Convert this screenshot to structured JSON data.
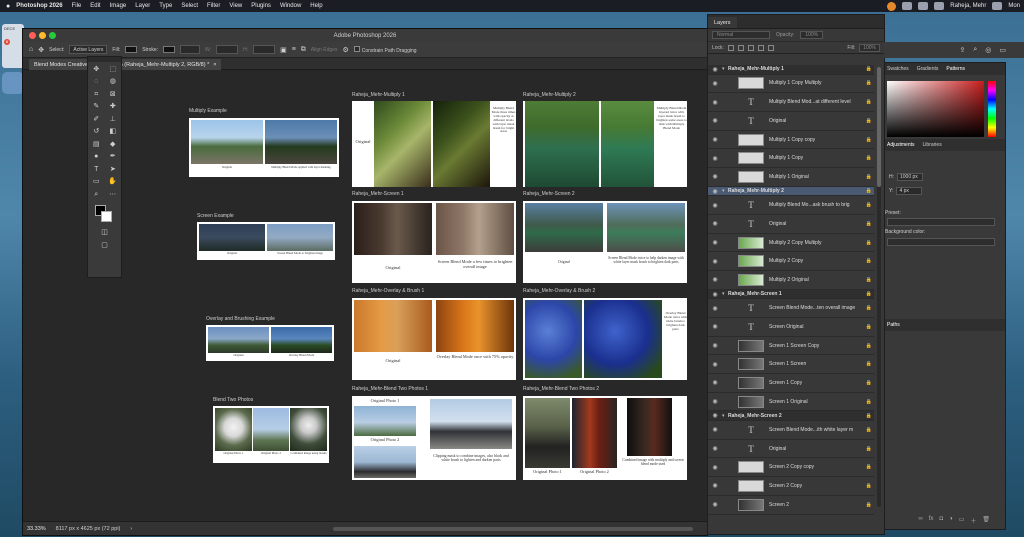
{
  "menubar": {
    "app_name": "Photoshop 2026",
    "items": [
      "File",
      "Edit",
      "Image",
      "Layer",
      "Type",
      "Select",
      "Filter",
      "View",
      "Plugins",
      "Window",
      "Help"
    ],
    "user": "Raheja, Mehr",
    "clock": "Mon"
  },
  "desktop": {
    "calendar_label": "DECE",
    "calendar_today": "8"
  },
  "window": {
    "title": "Adobe Photoshop 2026"
  },
  "options_bar": {
    "select_label": "Select:",
    "select_value": "Active Layers",
    "fill_label": "Fill:",
    "stroke_label": "Stroke:",
    "w_label": "W:",
    "h_label": "H:",
    "align_edges": "Align Edges",
    "constrain_label": "Constrain Path Dragging"
  },
  "document_tab": {
    "title": "Blend Modes Creative.psd @ 33.3% (Raheja_Mehr-Multiply 2, RGB/8) *"
  },
  "status_bar": {
    "zoom": "33.33%",
    "doc_size": "8117 px x 4625 px (72 ppi)"
  },
  "artboards": {
    "multiply_example": {
      "label": "Multiply Example",
      "cap_left": "Original",
      "cap_right": "Multiply Blend Mode applied with layer masking"
    },
    "screen_example": {
      "label": "Screen Example",
      "cap_left": "Original",
      "cap_right": "Screen Blend Mode to brighten image"
    },
    "overlay_example": {
      "label": "Overlay and Brushing Example",
      "cap_left": "Original",
      "cap_right": "Overlay Blend Mode"
    },
    "blend_two_example": {
      "label": "Blend Two Photos",
      "cap_1": "Original Photo 1",
      "cap_2": "Original Photo 2",
      "cap_3": "Combined image using masks"
    },
    "multiply1": {
      "label": "Raheja_Mehr-Multiply 1",
      "cap_left": "Original",
      "cap_right": "Multiply Blend Mode three times with opacity at different levels with layer mask brush for bright areas"
    },
    "multiply2": {
      "label": "Raheja_Mehr-Multiply 2",
      "cap_right": "Multiply Blend Mode layered twice with layer mask brush to brighten some areas to dark with Multiply Blend Mode"
    },
    "screen1": {
      "label": "Raheja_Mehr-Screen 1",
      "cap_left": "Original",
      "cap_right": "Screen Blend Mode a few times to brighten overall image"
    },
    "screen2": {
      "label": "Raheja_Mehr-Screen 2",
      "cap_left": "Original",
      "cap_right": "Screen Blend Mode twice to help darken image with white layer mask brush to brighten dark parts"
    },
    "overlay1": {
      "label": "Raheja_Mehr-Overlay & Brush 1",
      "cap_left": "Original",
      "cap_right": "Overlay Blend Mode once with 75% opacity"
    },
    "overlay2": {
      "label": "Raheja_Mehr-Overlay & Brush 2",
      "cap_right": "Overlay Blend Mode twice with white brush to brighten dark parts"
    },
    "blend1": {
      "label": "Raheja_Mehr-Blend Two Photos 1",
      "cap_top": "Original Photo 1",
      "cap_mid": "Original Photo 2",
      "cap_right": "Clipping mask to combine images, also black and white brush to lighten and darken parts"
    },
    "blend2": {
      "label": "Raheja_Mehr-Blend Two Photos 2",
      "cap_1": "Original Photo 1",
      "cap_2": "Original Photo 2",
      "cap_3": "Combined image with multiply and screen blend mode used"
    }
  },
  "layers_panel": {
    "tab": "Layers",
    "blend_mode": "Normal",
    "opacity_label": "Opacity:",
    "opacity_value": "100%",
    "lock_label": "Lock:",
    "fill_label": "Fill:",
    "fill_value": "100%",
    "rows": [
      {
        "kind": "group",
        "name": "Raheja_Mehr-Multiply 1"
      },
      {
        "kind": "image",
        "name": "Multiply 1 Copy Multiply",
        "thumb": "light"
      },
      {
        "kind": "text",
        "name": "Multiply Blend Mod...at different level"
      },
      {
        "kind": "text",
        "name": "Original"
      },
      {
        "kind": "image",
        "name": "Multiply 1 Copy copy",
        "thumb": "light"
      },
      {
        "kind": "image",
        "name": "Multiply 1 Copy",
        "thumb": "light"
      },
      {
        "kind": "image",
        "name": "Multiply 1 Original",
        "thumb": "light"
      },
      {
        "kind": "group",
        "name": "Raheja_Mehr-Multiply 2",
        "selected": true
      },
      {
        "kind": "text",
        "name": "Multiply Blend Mo...ask brush to brig"
      },
      {
        "kind": "text",
        "name": "Original"
      },
      {
        "kind": "image",
        "name": "Multiply 2 Copy Multiply",
        "thumb": "green"
      },
      {
        "kind": "image",
        "name": "Multiply 2 Copy",
        "thumb": "green"
      },
      {
        "kind": "image",
        "name": "Multiply 2 Original",
        "thumb": "green"
      },
      {
        "kind": "group",
        "name": "Raheja_Mehr-Screen 1"
      },
      {
        "kind": "text",
        "name": "Screen Blend Mode...ten overall image"
      },
      {
        "kind": "text",
        "name": "Screen Original"
      },
      {
        "kind": "image",
        "name": "Screen 1 Screen Copy",
        "thumb": "dark"
      },
      {
        "kind": "image",
        "name": "Screen 1 Screen",
        "thumb": "dark"
      },
      {
        "kind": "image",
        "name": "Screen 1 Copy",
        "thumb": "dark"
      },
      {
        "kind": "image",
        "name": "Screen 1 Original",
        "thumb": "dark"
      },
      {
        "kind": "group",
        "name": "Raheja_Mehr-Screen 2"
      },
      {
        "kind": "text",
        "name": "Screen Blend Mode...ith white layer m"
      },
      {
        "kind": "text",
        "name": "Original"
      },
      {
        "kind": "image",
        "name": "Screen 2 Copy copy",
        "thumb": "light"
      },
      {
        "kind": "image",
        "name": "Screen 2 Copy",
        "thumb": "light"
      },
      {
        "kind": "image",
        "name": "Screen 2",
        "thumb": "dark"
      }
    ]
  },
  "right_panel": {
    "tabs": [
      "Swatches",
      "Gradients",
      "Patterns"
    ],
    "tabs2": [
      "Adjustments",
      "Libraries"
    ],
    "h_label": "H:",
    "h_value": "1000 px",
    "y_label": "Y:",
    "y_value": "4 px",
    "preset_label": "Preset:",
    "bg_label": "Background color:",
    "paths_tab": "Paths"
  },
  "colors": {
    "accent_selected": "#4a5a72",
    "canvas": "#282828"
  }
}
